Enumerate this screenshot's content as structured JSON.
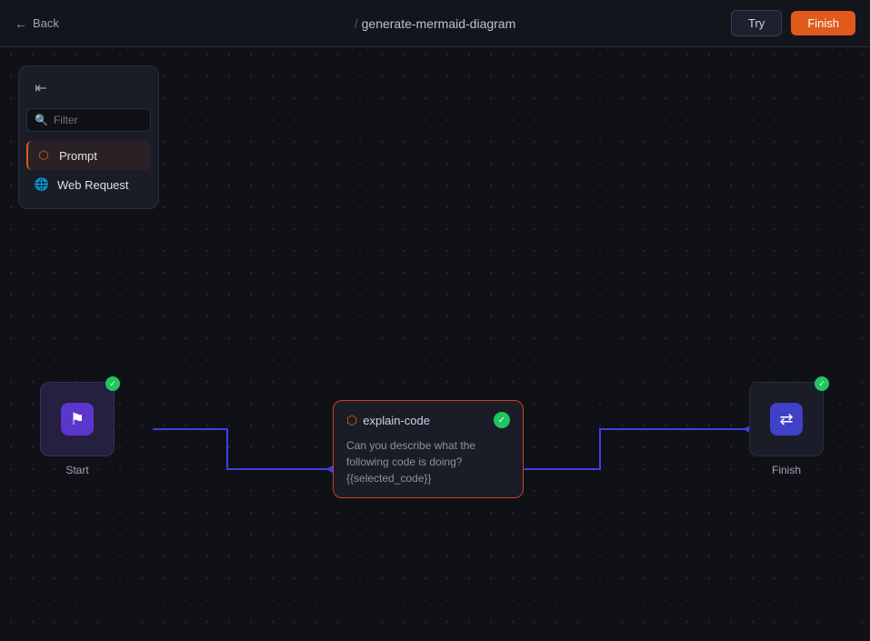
{
  "header": {
    "back_label": "Back",
    "slash": "/",
    "route_name": "generate-mermaid-diagram",
    "try_label": "Try",
    "finish_label": "Finish"
  },
  "sidebar": {
    "collapse_icon": "≡",
    "filter_placeholder": "Filter",
    "items": [
      {
        "id": "prompt",
        "label": "Prompt",
        "icon_type": "prompt",
        "active": true
      },
      {
        "id": "web-request",
        "label": "Web Request",
        "icon_type": "web",
        "active": false
      }
    ]
  },
  "flow": {
    "start_label": "Start",
    "finish_label": "Finish",
    "prompt_node": {
      "title": "explain-code",
      "body": "Can you describe what the following code is doing? {{selected_code}}"
    }
  }
}
